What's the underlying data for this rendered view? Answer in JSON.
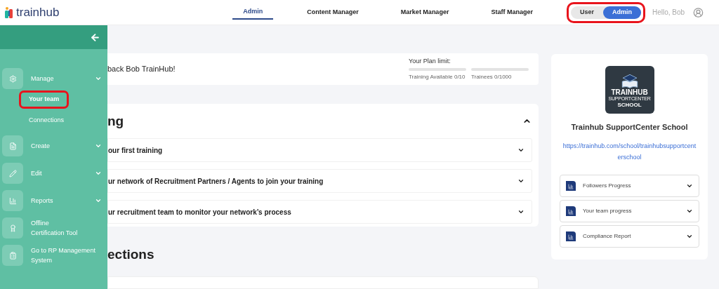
{
  "header": {
    "logo": "trainhub",
    "nav": [
      {
        "label": "Admin",
        "selected": true
      },
      {
        "label": "Content Manager",
        "selected": false
      },
      {
        "label": "Market Manager",
        "selected": false
      },
      {
        "label": "Staff Manager",
        "selected": false
      }
    ],
    "role_toggle": {
      "highlighted": true,
      "options": [
        {
          "label": "User",
          "selected": false
        },
        {
          "label": "Admin",
          "selected": true
        }
      ]
    },
    "greeting": "Hello, Bob"
  },
  "sidebar": {
    "items": [
      {
        "kind": "group",
        "label": "Manage",
        "children": [
          {
            "label": "Your team",
            "highlighted": true
          },
          {
            "label": "Connections",
            "highlighted": false
          }
        ]
      },
      {
        "kind": "group",
        "label": "Create"
      },
      {
        "kind": "group",
        "label": "Edit"
      },
      {
        "kind": "group",
        "label": "Reports"
      },
      {
        "kind": "link",
        "label": "Offline\nCertification Tool"
      },
      {
        "kind": "link",
        "label": "Go to RP Management\nSystem"
      }
    ]
  },
  "welcome": {
    "text": "back Bob TrainHub!",
    "plan": {
      "title": "Your Plan limit:",
      "meters": [
        {
          "label": "Training Available 0/10",
          "level": 0
        },
        {
          "label": "Trainees 0/1000",
          "level": 0
        }
      ]
    }
  },
  "training": {
    "title": "ng",
    "expanded": true,
    "steps": [
      {
        "label": "our first training",
        "expanded": false
      },
      {
        "label": "ur network of Recruitment Partners / Agents to join your training",
        "expanded": false
      },
      {
        "label": "ur recruitment team to monitor your network’s process",
        "expanded": false
      }
    ]
  },
  "connections": {
    "title": "ections"
  },
  "school": {
    "logo_lines": [
      "TRAINHUB",
      "SUPPORTCENTER",
      "SCHOOL"
    ],
    "name": "Trainhub SupportCenter School",
    "url": "https://trainhub.com/school/trainhubsupportcenterschool",
    "reports": [
      {
        "label": "Followers Progress",
        "expanded": false
      },
      {
        "label": "Your team progress",
        "expanded": false
      },
      {
        "label": "Compliance Report",
        "expanded": false
      }
    ]
  }
}
